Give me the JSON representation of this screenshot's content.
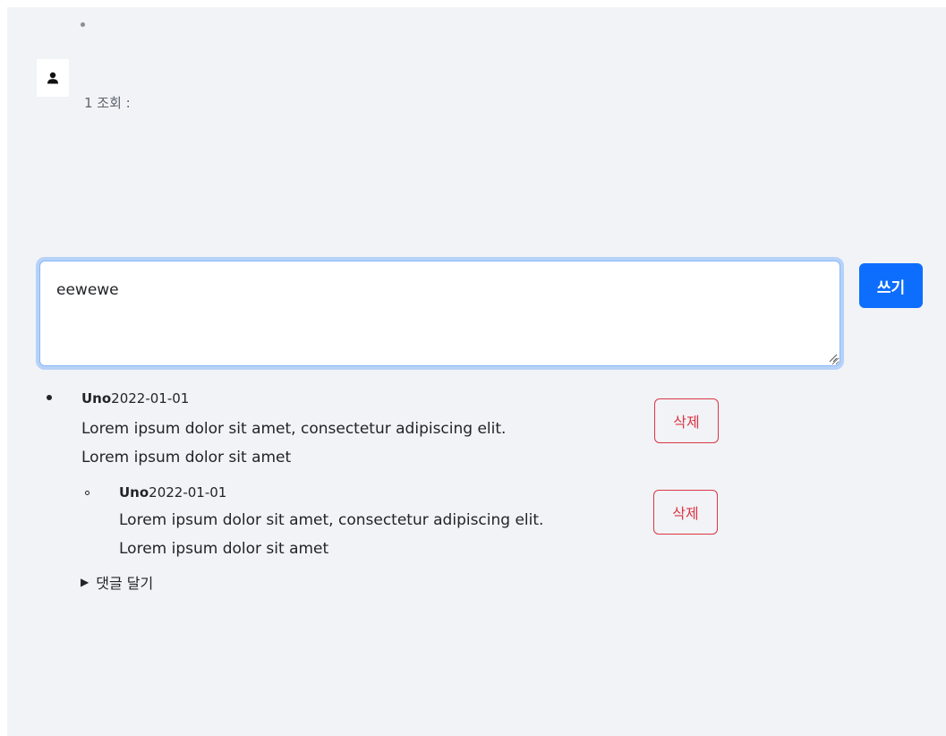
{
  "post": {
    "view_meta": "1 조회 :"
  },
  "compose": {
    "value": "eewewe",
    "submit_label": "쓰기"
  },
  "comments": [
    {
      "author": "Uno",
      "date": "2022-01-01",
      "line1": "Lorem ipsum dolor sit amet, consectetur adipiscing elit.",
      "line2": "Lorem ipsum dolor sit amet",
      "delete_label": "삭제"
    },
    {
      "author": "Uno",
      "date": "2022-01-01",
      "line1": "Lorem ipsum dolor sit amet, consectetur adipiscing elit.",
      "line2": "Lorem ipsum dolor sit amet",
      "delete_label": "삭제"
    }
  ],
  "reply_toggle": {
    "label": "댓글 달기",
    "icon": "triangle-right-icon"
  },
  "colors": {
    "primary": "#0d6efd",
    "danger": "#dc3545",
    "background": "#f1f3f6"
  }
}
